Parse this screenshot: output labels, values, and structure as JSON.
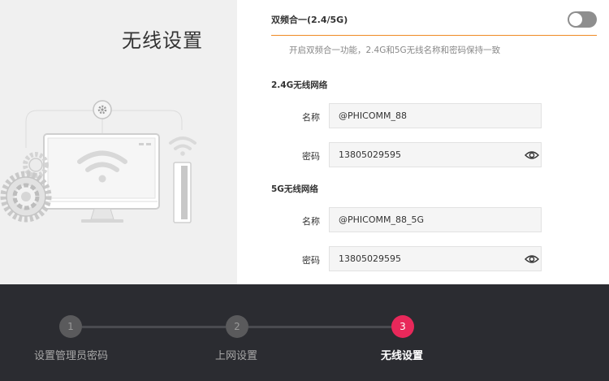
{
  "page": {
    "title": "无线设置"
  },
  "dual_band": {
    "label": "双频合一(2.4/5G)",
    "enabled": false,
    "hint": "开启双频合一功能，2.4G和5G无线名称和密码保持一致"
  },
  "band_24g": {
    "heading": "2.4G无线网络",
    "name_label": "名称",
    "name_value": "@PHICOMM_88",
    "password_label": "密码",
    "password_value": "13805029595"
  },
  "band_5g": {
    "heading": "5G无线网络",
    "name_label": "名称",
    "name_value": "@PHICOMM_88_5G",
    "password_label": "密码",
    "password_value": "13805029595"
  },
  "steps": [
    {
      "number": "1",
      "label": "设置管理员密码",
      "active": false
    },
    {
      "number": "2",
      "label": "上网设置",
      "active": false
    },
    {
      "number": "3",
      "label": "无线设置",
      "active": true
    }
  ],
  "colors": {
    "accent": "#e8285a",
    "divider": "#f08a24",
    "footer_bg": "#2b2c31"
  }
}
